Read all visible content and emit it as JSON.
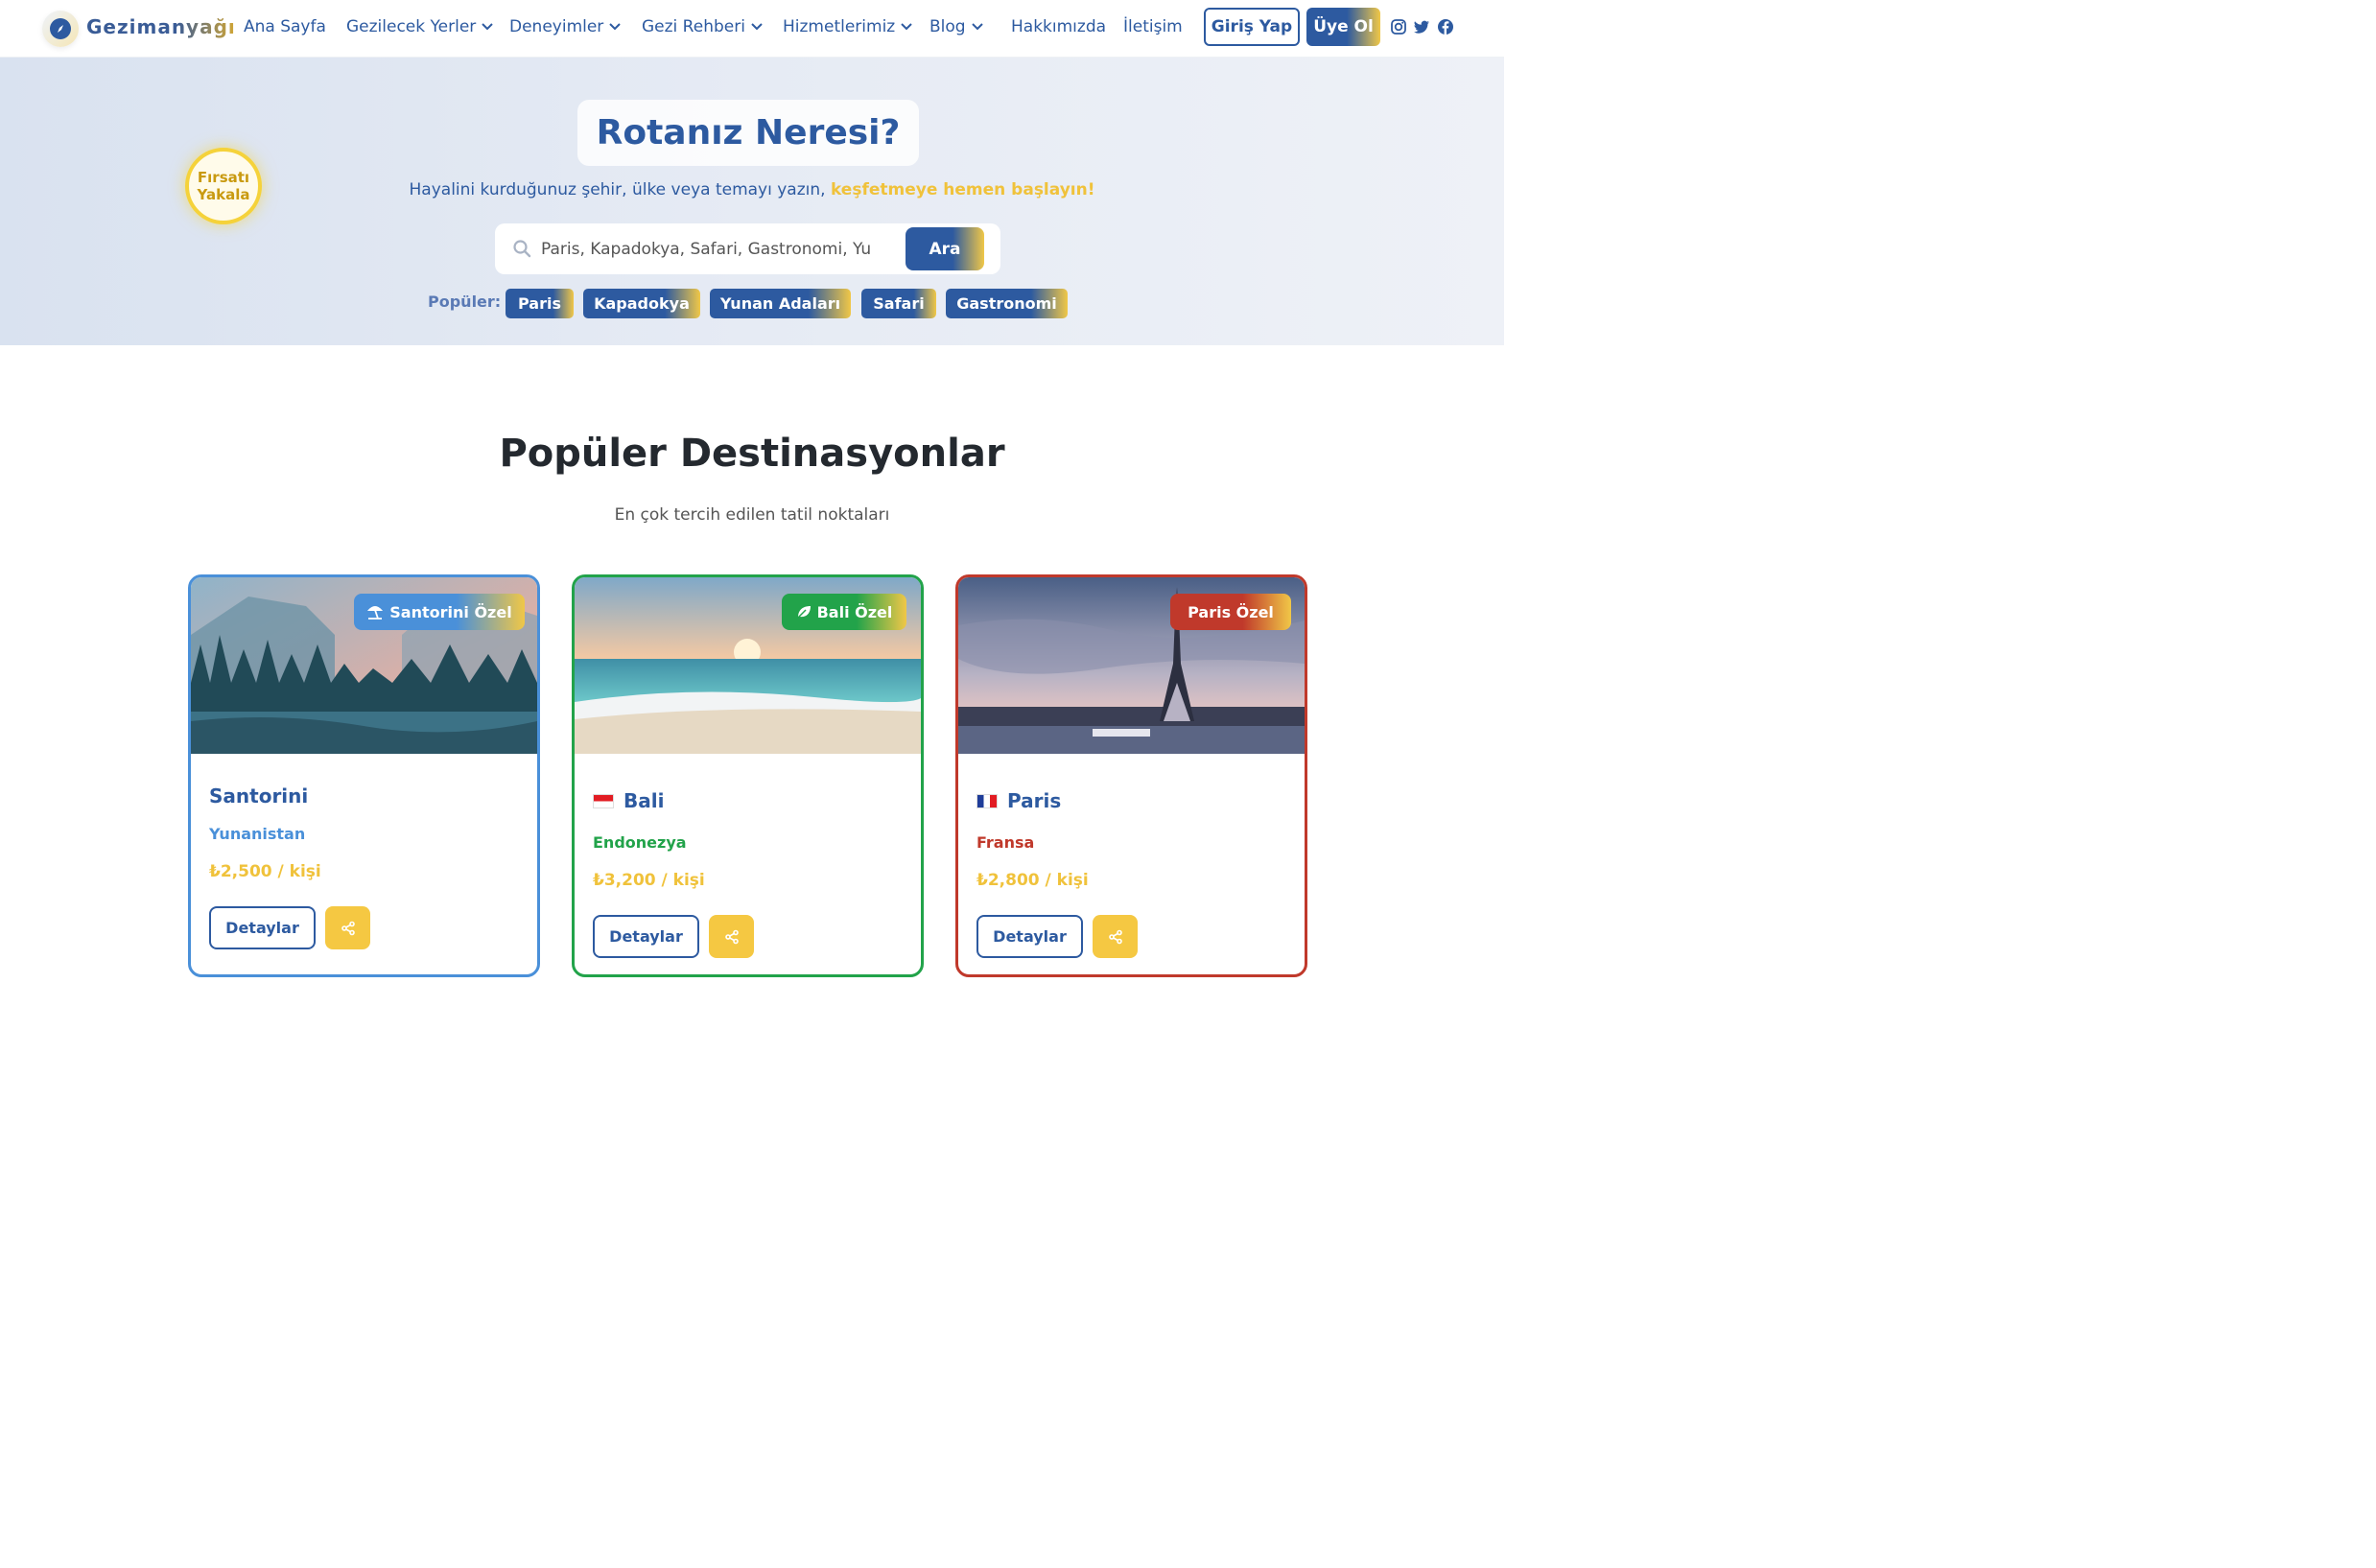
{
  "brand": {
    "name": "Gezimanyağı"
  },
  "nav": {
    "items": [
      {
        "label": "Ana Sayfa",
        "dropdown": false
      },
      {
        "label": "Gezilecek Yerler",
        "dropdown": true
      },
      {
        "label": "Deneyimler",
        "dropdown": true
      },
      {
        "label": "Gezi Rehberi",
        "dropdown": true
      },
      {
        "label": "Hizmetlerimiz",
        "dropdown": true
      },
      {
        "label": "Blog",
        "dropdown": true
      },
      {
        "label": "Hakkımızda",
        "dropdown": false
      },
      {
        "label": "İletişim",
        "dropdown": false
      }
    ],
    "login_label": "Giriş Yap",
    "signup_label": "Üye Ol",
    "social": [
      "instagram-icon",
      "twitter-icon",
      "facebook-icon"
    ]
  },
  "hero": {
    "title": "Rotanız Neresi?",
    "subtitle": "Hayalini kurduğunuz şehir, ülke veya temayı yazın,",
    "subtitle_highlight": "keşfetmeye hemen başlayın!",
    "badge_line1": "Fırsatı",
    "badge_line2": "Yakala",
    "search_placeholder": "Paris, Kapadokya, Safari, Gastronomi, Yunan...",
    "search_button": "Ara",
    "popular_label": "Popüler:",
    "popular_tags": [
      "Paris",
      "Kapadokya",
      "Yunan Adaları",
      "Safari",
      "Gastronomi"
    ]
  },
  "section": {
    "title": "Popüler Destinasyonlar",
    "subtitle": "En çok tercih edilen tatil noktaları"
  },
  "cards": [
    {
      "badge": "Santorini Özel",
      "badge_icon": "beach-umbrella-icon",
      "name": "Santorini",
      "flag": "",
      "country": "Yunanistan",
      "price": "₺2,500 / kişi",
      "details_label": "Detaylar",
      "accent": "#4a90d9"
    },
    {
      "badge": "Bali Özel",
      "badge_icon": "leaf-icon",
      "name": "Bali",
      "flag": "indonesia-flag",
      "country": "Endonezya",
      "price": "₺3,200 / kişi",
      "details_label": "Detaylar",
      "accent": "#22a34a"
    },
    {
      "badge": "Paris Özel",
      "badge_icon": "",
      "name": "Paris",
      "flag": "france-flag",
      "country": "Fransa",
      "price": "₺2,800 / kişi",
      "details_label": "Detaylar",
      "accent": "#c0392b"
    }
  ]
}
